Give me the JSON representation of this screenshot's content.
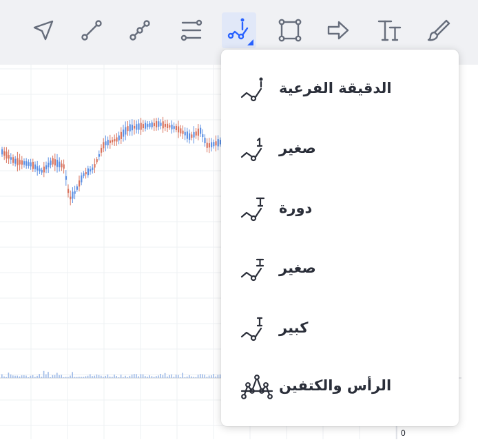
{
  "toolbar": {
    "tools": [
      {
        "icon": "cursor-arrow-icon"
      },
      {
        "icon": "trend-line-icon"
      },
      {
        "icon": "info-line-icon"
      },
      {
        "icon": "lines-settings-icon"
      },
      {
        "icon": "elliott-wave-icon",
        "active": true
      },
      {
        "icon": "rectangle-icon"
      },
      {
        "icon": "arrow-icon"
      },
      {
        "icon": "text-icon"
      },
      {
        "icon": "brush-icon"
      }
    ]
  },
  "menu": {
    "items": [
      {
        "label": "الدقيقة الفرعية",
        "icon": "elliott-wave-subminuette-icon"
      },
      {
        "label": "صغير",
        "icon": "elliott-wave-minor-numbered-icon"
      },
      {
        "label": "دورة",
        "icon": "elliott-wave-cycle-icon"
      },
      {
        "label": "صغير",
        "icon": "elliott-wave-minor-triangle-icon"
      },
      {
        "label": "كبير",
        "icon": "elliott-wave-major-icon"
      },
      {
        "label": "الرأس والكتفين",
        "icon": "head-and-shoulders-icon"
      }
    ]
  },
  "chart": {
    "price_axis_label": "0",
    "colors": {
      "up": "#5b8fe3",
      "down": "#d9735d",
      "grid": "#eef0f3",
      "volume": "#9fbbe8"
    }
  }
}
